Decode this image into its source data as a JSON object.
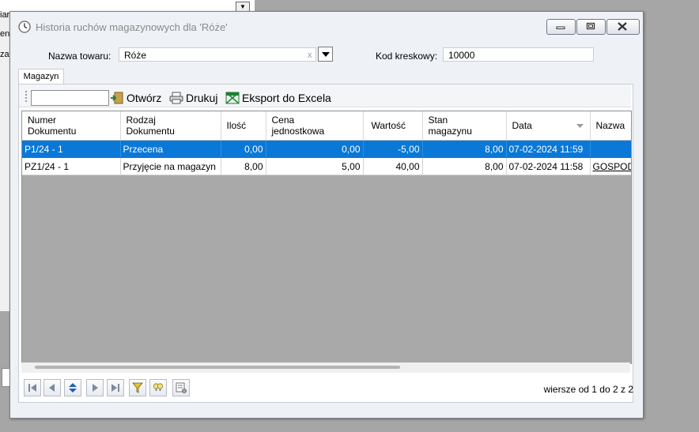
{
  "background": {
    "side_labels": [
      "iar",
      "en",
      "zav"
    ]
  },
  "window": {
    "title": "Historia ruchów magazynowych dla 'Róże'",
    "product_label": "Nazwa towaru:",
    "product_value": "Róże",
    "barcode_label": "Kod kreskowy:",
    "barcode_value": "10000"
  },
  "tab": {
    "label": "Magazyn"
  },
  "toolbar": {
    "open_label": "Otwórz",
    "print_label": "Drukuj",
    "export_label": "Eksport do Excela"
  },
  "table": {
    "columns": [
      {
        "line1": "Numer",
        "line2": "Dokumentu"
      },
      {
        "line1": "Rodzaj",
        "line2": "Dokumentu"
      },
      {
        "line1": "Ilość",
        "line2": ""
      },
      {
        "line1": "Cena",
        "line2": "jednostkowa"
      },
      {
        "line1": "Wartość",
        "line2": ""
      },
      {
        "line1": "Stan",
        "line2": "magazynu"
      },
      {
        "line1": "Data",
        "line2": ""
      },
      {
        "line1": "Nazwa",
        "line2": ""
      }
    ],
    "rows": [
      {
        "doc": "P1/24 - 1",
        "type": "Przecena",
        "qty": "0,00",
        "price": "0,00",
        "value": "-5,00",
        "stock": "8,00",
        "date": "07-02-2024 11:59",
        "name": ""
      },
      {
        "doc": "PZ1/24 - 1",
        "type": "Przyjęcie na magazyn",
        "qty": "8,00",
        "price": "5,00",
        "value": "40,00",
        "stock": "8,00",
        "date": "07-02-2024 11:58",
        "name": "GOSPOD"
      }
    ],
    "selected_row": 0
  },
  "footer": {
    "row_count": "wiersze od 1 do 2 z 2"
  },
  "colors": {
    "selection": "#0a78d7",
    "grid_background": "#a9a9a9"
  }
}
